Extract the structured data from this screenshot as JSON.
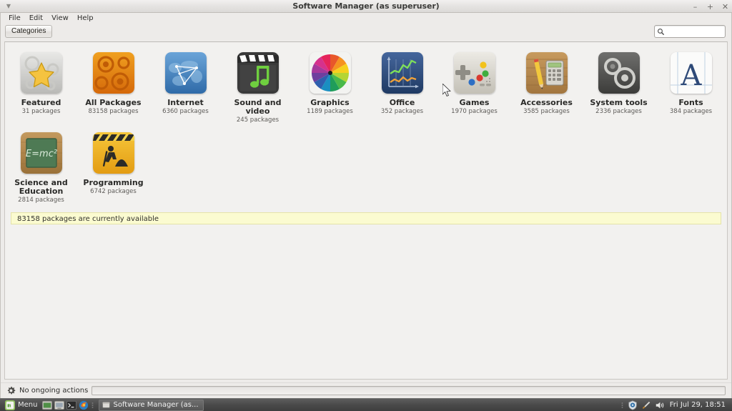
{
  "window": {
    "title": "Software Manager (as superuser)",
    "menu_icon": "window-menu-triangle",
    "controls": {
      "minimize": "–",
      "maximize": "+",
      "close": "✕"
    }
  },
  "menubar": {
    "items": [
      "File",
      "Edit",
      "View",
      "Help"
    ]
  },
  "toolbar": {
    "categories_label": "Categories",
    "search": {
      "value": "",
      "placeholder": "",
      "icon": "search-icon",
      "clear_icon": "clear-icon"
    }
  },
  "categories": [
    {
      "name": "Featured",
      "count": "31 packages",
      "icon": "featured-star-icon"
    },
    {
      "name": "All Packages",
      "count": "83158 packages",
      "icon": "all-packages-gears-icon"
    },
    {
      "name": "Internet",
      "count": "6360 packages",
      "icon": "internet-globe-icon"
    },
    {
      "name": "Sound and video",
      "count": "245 packages",
      "icon": "sound-video-icon"
    },
    {
      "name": "Graphics",
      "count": "1189 packages",
      "icon": "graphics-colorwheel-icon"
    },
    {
      "name": "Office",
      "count": "352 packages",
      "icon": "office-chart-icon"
    },
    {
      "name": "Games",
      "count": "1970 packages",
      "icon": "games-gamepad-icon"
    },
    {
      "name": "Accessories",
      "count": "3585 packages",
      "icon": "accessories-calculator-icon"
    },
    {
      "name": "System tools",
      "count": "2336 packages",
      "icon": "system-tools-gears-icon"
    },
    {
      "name": "Fonts",
      "count": "384 packages",
      "icon": "fonts-letter-a-icon"
    },
    {
      "name": "Science and Education",
      "count": "2814 packages",
      "icon": "science-education-blackboard-icon"
    },
    {
      "name": "Programming",
      "count": "6742 packages",
      "icon": "programming-construction-icon"
    }
  ],
  "notice": {
    "text": "83158 packages are currently available"
  },
  "statusbar": {
    "icon": "gear-icon",
    "text": "No ongoing actions",
    "progress_value": 0
  },
  "taskbar": {
    "menu_label": "Menu",
    "menu_icon": "mint-logo-icon",
    "launchers": [
      "show-desktop-icon",
      "file-manager-icon",
      "terminal-icon",
      "firefox-icon"
    ],
    "window_button": {
      "label": "Software Manager (as...",
      "icon": "window-icon"
    },
    "tray": [
      "update-shield-icon",
      "brush-icon",
      "volume-icon"
    ],
    "clock": "Fri Jul 29, 18:51"
  },
  "colors": {
    "notice_bg": "#fbfbd0",
    "window_bg": "#edebe9",
    "content_bg": "#f2f1ef",
    "taskbar_bg": "#4a4a4a"
  }
}
